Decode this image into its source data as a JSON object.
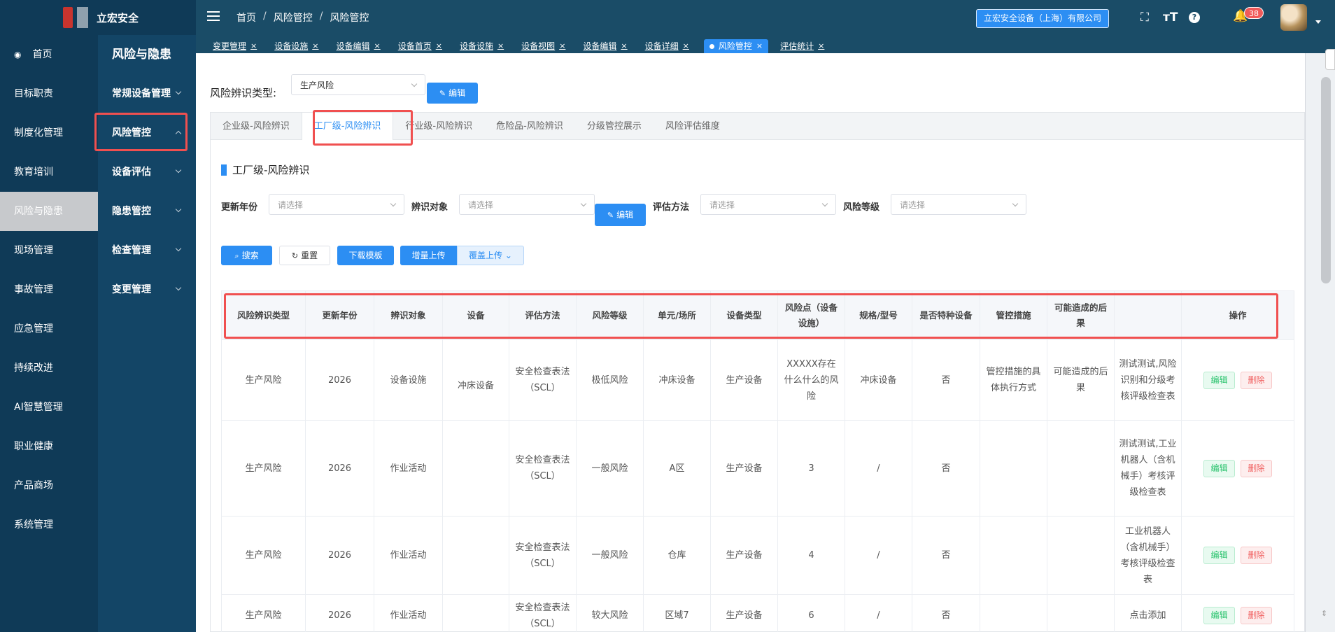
{
  "app": {
    "name": "立宏安全",
    "company_button": "立宏安全设备（上海）有限公司",
    "notification_count": "38"
  },
  "breadcrumb": [
    "首页",
    "风险管控",
    "风险管控"
  ],
  "tags": [
    {
      "label": "变更管理",
      "active": false
    },
    {
      "label": "设备设施",
      "active": false
    },
    {
      "label": "设备编辑",
      "active": false
    },
    {
      "label": "设备首页",
      "active": false
    },
    {
      "label": "设备设施",
      "active": false
    },
    {
      "label": "设备视图",
      "active": false
    },
    {
      "label": "设备编辑",
      "active": false
    },
    {
      "label": "设备详细",
      "active": false
    },
    {
      "label": "风险管控",
      "active": true
    },
    {
      "label": "评估统计",
      "active": false
    }
  ],
  "sidebar": {
    "items": [
      "首页",
      "目标职责",
      "制度化管理",
      "教育培训",
      "风险与隐患",
      "现场管理",
      "事故管理",
      "应急管理",
      "持续改进",
      "AI智慧管理",
      "职业健康",
      "产品商场",
      "系统管理"
    ],
    "active_index": 4
  },
  "submenu": {
    "title": "风险与隐患",
    "items": [
      "常规设备管理",
      "风险管控",
      "设备评估",
      "隐患管控",
      "检查管理",
      "变更管理"
    ]
  },
  "filter_top": {
    "label": "风险辨识类型:",
    "value": "生产风险",
    "edit_label": "编辑"
  },
  "tabs": [
    "企业级-风险辨识",
    "工厂级-风险辨识",
    "行业级-风险辨识",
    "危险品-风险辨识",
    "分级管控展示",
    "风险评估维度"
  ],
  "active_tab": 1,
  "section_title": "工厂级-风险辨识",
  "filters": {
    "year": {
      "label": "更新年份",
      "placeholder": "请选择"
    },
    "object": {
      "label": "辨识对象",
      "placeholder": "请选择"
    },
    "method": {
      "label": "评估方法",
      "placeholder": "请选择"
    },
    "level": {
      "label": "风险等级",
      "placeholder": "请选择"
    },
    "edit_label": "编辑"
  },
  "actions": {
    "search": "搜索",
    "reset": "重置",
    "download": "下载模板",
    "incremental_upload": "增量上传",
    "overwrite_upload": "覆盖上传"
  },
  "table": {
    "columns": [
      "风险辨识类型",
      "更新年份",
      "辨识对象",
      "设备",
      "评估方法",
      "风险等级",
      "单元/场所",
      "设备类型",
      "风险点（设备设施）",
      "规格/型号",
      "是否特种设备",
      "管控措施",
      "可能造成的后果",
      "",
      "操作"
    ],
    "rows": [
      [
        "生产风险",
        "2026",
        "设备设施",
        "冲床设备",
        "安全检查表法（SCL）",
        "极低风险",
        "冲床设备",
        "生产设备",
        "XXXXX存在什么什么的风险",
        "冲床设备",
        "否",
        "管控措施的具体执行方式",
        "可能造成的后果",
        "测试测试,风险识别和分级考核评级检查表"
      ],
      [
        "生产风险",
        "2026",
        "作业活动",
        "",
        "安全检查表法（SCL）",
        "一般风险",
        "A区",
        "生产设备",
        "3",
        "/",
        "否",
        "",
        "",
        "测试测试,工业机器人（含机械手）考核评级检查表"
      ],
      [
        "生产风险",
        "2026",
        "作业活动",
        "",
        "安全检查表法（SCL）",
        "一般风险",
        "仓库",
        "生产设备",
        "4",
        "/",
        "否",
        "",
        "",
        "工业机器人（含机械手）考核评级检查表"
      ],
      [
        "生产风险",
        "2026",
        "作业活动",
        "",
        "安全检查表法（SCL）",
        "较大风险",
        "区域7",
        "生产设备",
        "6",
        "/",
        "否",
        "",
        "",
        "点击添加"
      ]
    ],
    "op_edit": "编辑",
    "op_delete": "删除"
  },
  "colors": {
    "primary": "#2c8ef3",
    "header": "#1a4c67",
    "sidebar": "#0f3a57",
    "highlight": "#f05050"
  }
}
